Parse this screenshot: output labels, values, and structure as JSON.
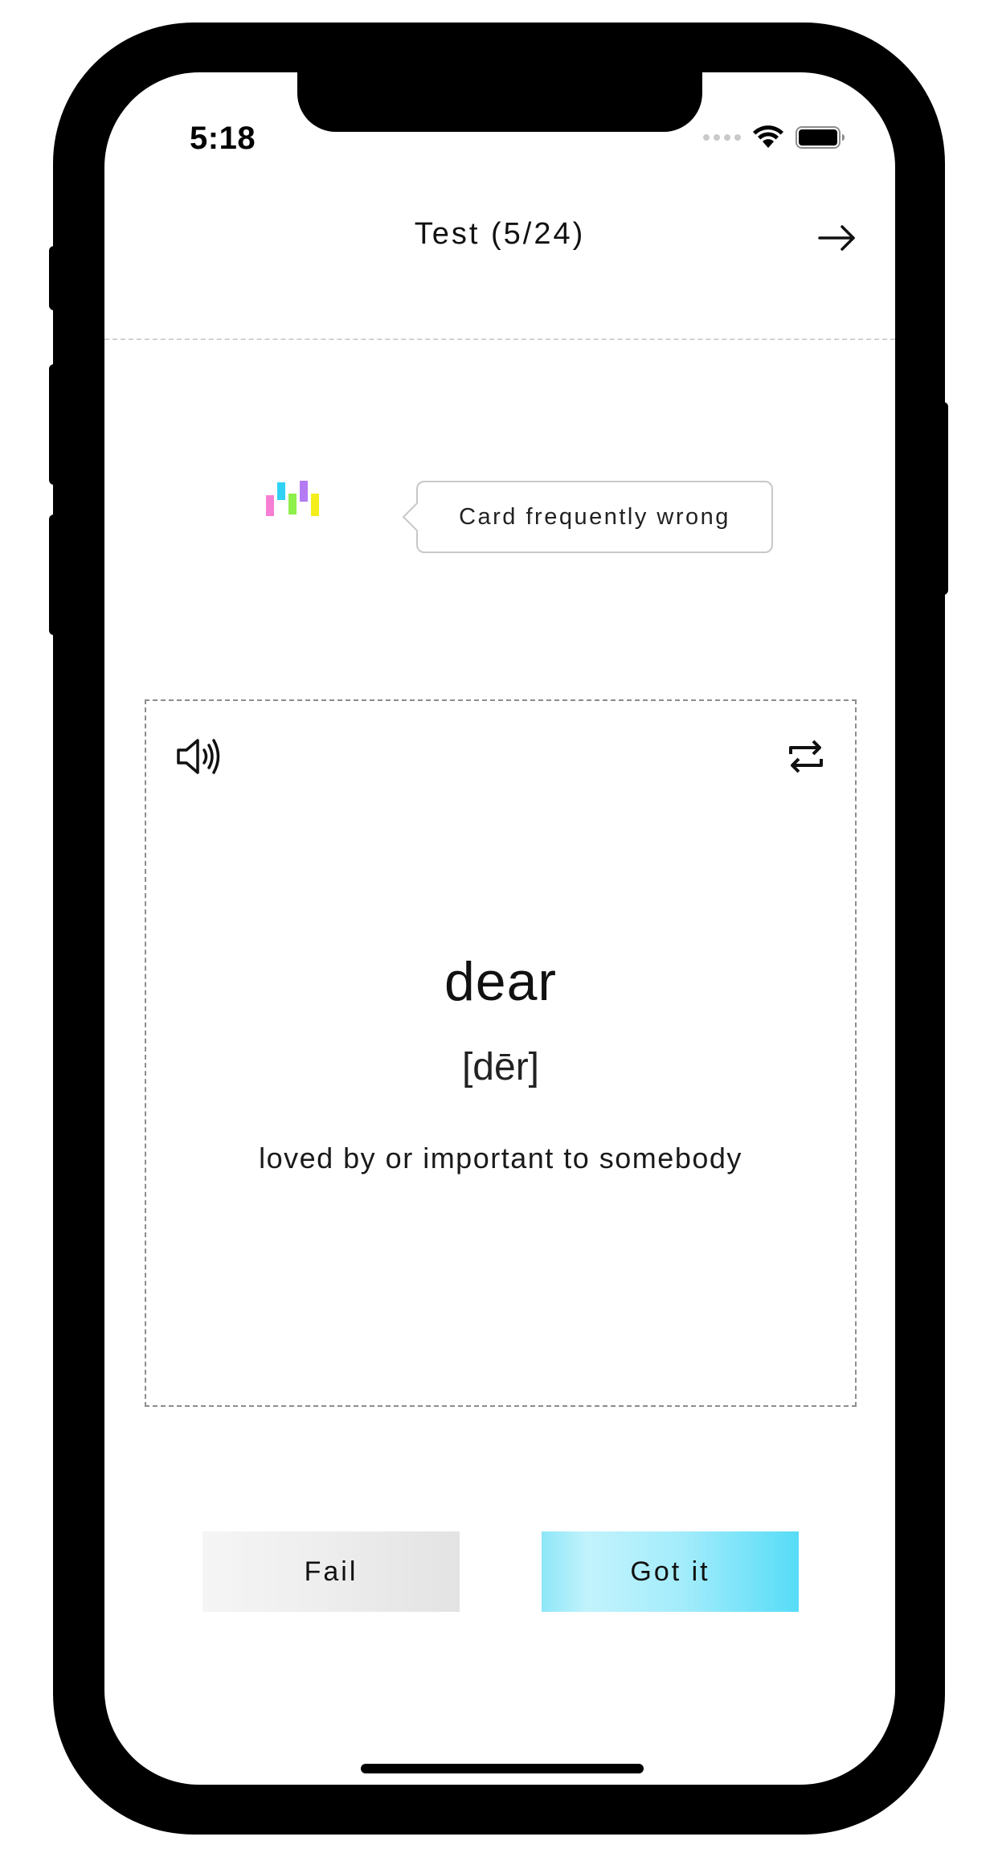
{
  "status_bar": {
    "time": "5:18"
  },
  "header": {
    "title": "Test (5/24)",
    "next_icon": "arrow-right-icon"
  },
  "tooltip": {
    "text": "Card frequently wrong",
    "icon": "difficulty-bars-icon",
    "bar_colors": [
      "#f77fd3",
      "#2fd2f5",
      "#8ef04a",
      "#b47bf4",
      "#f4ee1c"
    ]
  },
  "card": {
    "word": "dear",
    "phonetic": "[dēr]",
    "definition": "loved by or important to somebody",
    "audio_icon": "speaker-icon",
    "flip_icon": "repeat-icon"
  },
  "actions": {
    "fail_label": "Fail",
    "got_it_label": "Got it"
  },
  "colors": {
    "accent": "#56dcf7",
    "neutral_button": "#ececec"
  }
}
